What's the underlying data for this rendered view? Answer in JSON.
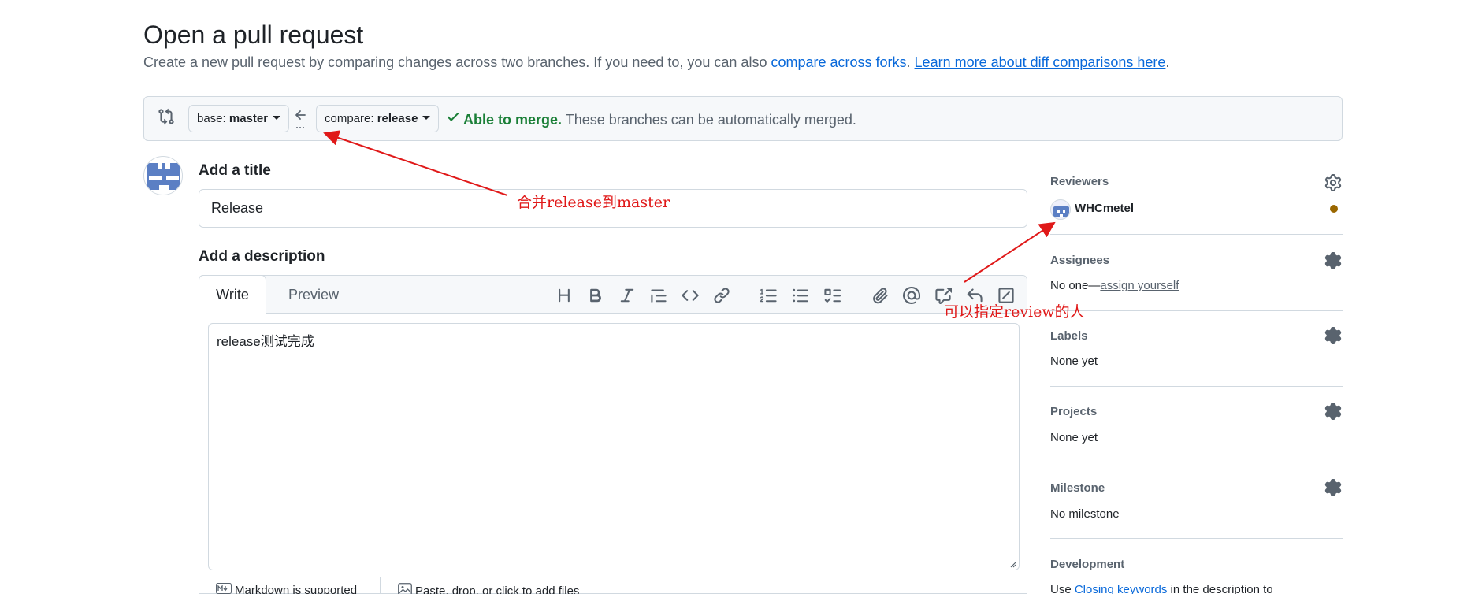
{
  "header": {
    "title": "Open a pull request",
    "subtitle_text": "Create a new pull request by comparing changes across two branches. If you need to, you can also ",
    "compare_forks_link": "compare across forks",
    "sep": ". ",
    "learn_more_link": "Learn more about diff comparisons here",
    "end": "."
  },
  "range": {
    "icon": "git-compare-icon",
    "base_prefix": "base: ",
    "base_branch": "master",
    "swap_icon": "arrow-left-icon",
    "compare_prefix": "compare: ",
    "compare_branch": "release",
    "merge_status": "Able to merge.",
    "merge_note": " These branches can be automatically merged."
  },
  "form": {
    "title_label": "Add a title",
    "title_value": "Release",
    "description_label": "Add a description",
    "tabs": [
      "Write",
      "Preview"
    ],
    "active_tab": "Write",
    "description_value": "release测试完成",
    "toolbar_icons": [
      "heading-icon",
      "bold-icon",
      "italic-icon",
      "quote-icon",
      "code-icon",
      "link-icon",
      "ordered-list-icon",
      "unordered-list-icon",
      "task-list-icon",
      "attach-icon",
      "mention-icon",
      "cross-reference-icon",
      "reply-icon",
      "slash-command-icon"
    ],
    "markdown_note": "Markdown is supported",
    "attach_note": "Paste, drop, or click to add files"
  },
  "sidebar": {
    "reviewers": {
      "label": "Reviewers",
      "name": "WHCmetel",
      "status_color": "#9a6700"
    },
    "assignees": {
      "label": "Assignees",
      "none": "No one—",
      "assign_link": "assign yourself"
    },
    "labels": {
      "label": "Labels",
      "value": "None yet"
    },
    "projects": {
      "label": "Projects",
      "value": "None yet"
    },
    "milestone": {
      "label": "Milestone",
      "value": "No milestone"
    },
    "development": {
      "label": "Development",
      "text_pre": "Use ",
      "link": "Closing keywords",
      "text_post": " in the description to"
    }
  },
  "annotations": {
    "merge_note": "合并release到master",
    "review_note": "可以指定review的人",
    "color": "#e01919"
  },
  "colors": {
    "link": "#0969da",
    "success": "#1a7f37",
    "muted": "#59636e",
    "border": "#d1d9e0"
  }
}
